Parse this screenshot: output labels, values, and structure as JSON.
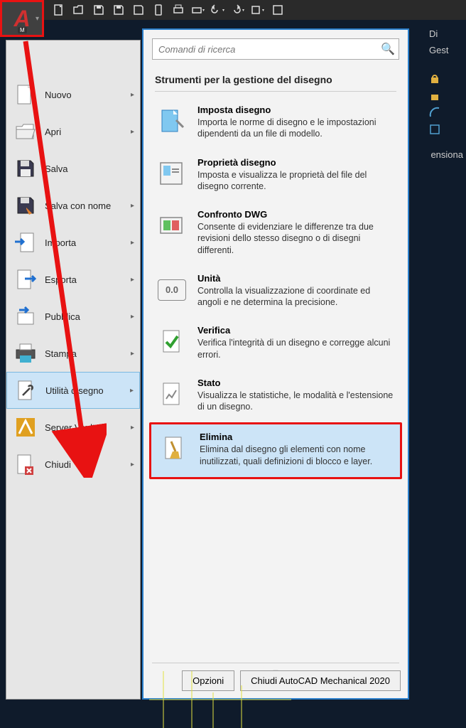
{
  "search": {
    "placeholder": "Comandi di ricerca"
  },
  "bg_tabs": {
    "t1": "Di",
    "t2": "Gest",
    "t3": "ensiona"
  },
  "menu": {
    "items": [
      {
        "label": "Nuovo"
      },
      {
        "label": "Apri"
      },
      {
        "label": "Salva"
      },
      {
        "label": "Salva con nome"
      },
      {
        "label": "Importa"
      },
      {
        "label": "Esporta"
      },
      {
        "label": "Pubblica"
      },
      {
        "label": "Stampa"
      },
      {
        "label": "Utilità disegno"
      },
      {
        "label": "Server Vault"
      },
      {
        "label": "Chiudi"
      }
    ]
  },
  "submenu": {
    "header": "Strumenti per la gestione del disegno",
    "items": [
      {
        "title": "Imposta disegno",
        "desc": "Importa le norme di disegno e le impostazioni dipendenti da un file di modello."
      },
      {
        "title": "Proprietà disegno",
        "desc": "Imposta e visualizza le proprietà del file del disegno corrente."
      },
      {
        "title": "Confronto DWG",
        "desc": "Consente di evidenziare le differenze tra due revisioni dello stesso disegno o di disegni differenti."
      },
      {
        "title": "Unità",
        "desc": "Controlla la visualizzazione di coordinate ed angoli e ne determina la precisione."
      },
      {
        "title": "Verifica",
        "desc": "Verifica l'integrità di un disegno e corregge alcuni errori."
      },
      {
        "title": "Stato",
        "desc": "Visualizza le statistiche, le modalità e l'estensione di un disegno."
      },
      {
        "title": "Elimina",
        "desc": "Elimina dal disegno gli elementi con nome inutilizzati, quali definizioni di blocco e layer."
      }
    ],
    "unit_label": "0.0"
  },
  "buttons": {
    "options": "Opzioni",
    "close": "Chiudi AutoCAD Mechanical 2020"
  }
}
